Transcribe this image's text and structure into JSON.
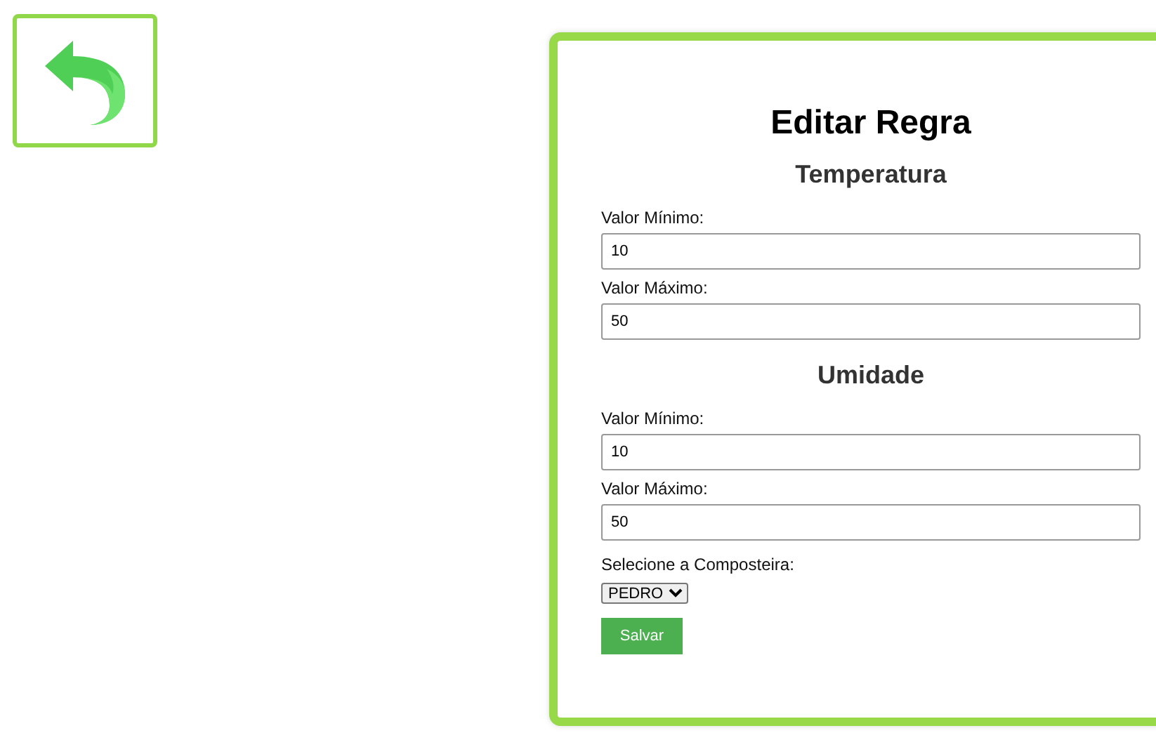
{
  "form": {
    "title": "Editar Regra",
    "sections": [
      {
        "heading": "Temperatura",
        "fields": [
          {
            "label": "Valor Mínimo:",
            "value": "10"
          },
          {
            "label": "Valor Máximo:",
            "value": "50"
          }
        ]
      },
      {
        "heading": "Umidade",
        "fields": [
          {
            "label": "Valor Mínimo:",
            "value": "10"
          },
          {
            "label": "Valor Máximo:",
            "value": "50"
          }
        ]
      }
    ],
    "select": {
      "label": "Selecione a Composteira:",
      "value": "PEDRO"
    },
    "submit_button": "Salvar"
  }
}
